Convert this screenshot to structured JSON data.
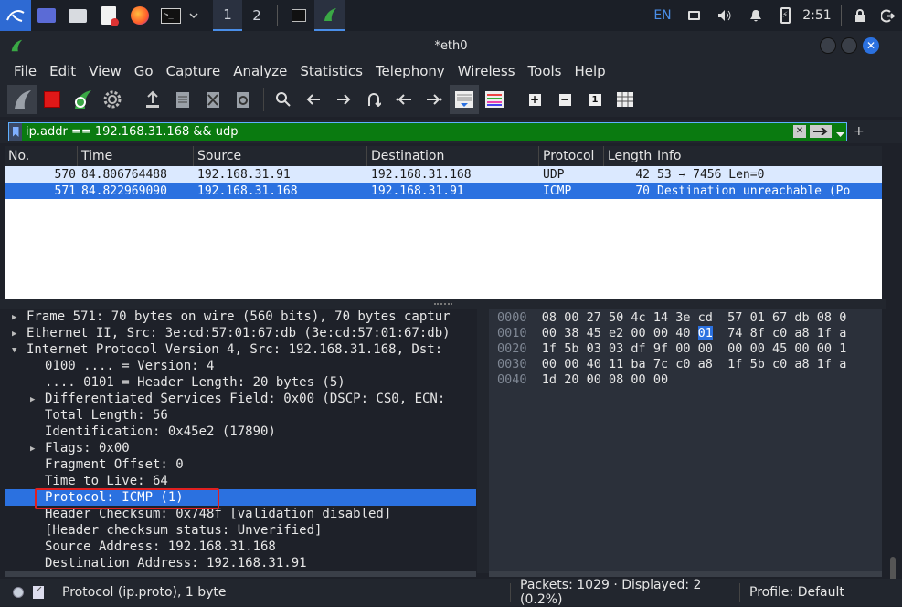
{
  "taskbar": {
    "workspaces": [
      "1",
      "2"
    ],
    "language": "EN",
    "clock": "2:51"
  },
  "window": {
    "title": "*eth0"
  },
  "menu": [
    "File",
    "Edit",
    "View",
    "Go",
    "Capture",
    "Analyze",
    "Statistics",
    "Telephony",
    "Wireless",
    "Tools",
    "Help"
  ],
  "filter": {
    "value": "ip.addr == 192.168.31.168 && udp"
  },
  "packet_list": {
    "columns": [
      "No.",
      "Time",
      "Source",
      "Destination",
      "Protocol",
      "Length",
      "Info"
    ],
    "rows": [
      {
        "no": "570",
        "time": "84.806764488",
        "source": "192.168.31.91",
        "destination": "192.168.31.168",
        "protocol": "UDP",
        "length": "42",
        "info": "53 → 7456 Len=0"
      },
      {
        "no": "571",
        "time": "84.822969090",
        "source": "192.168.31.168",
        "destination": "192.168.31.91",
        "protocol": "ICMP",
        "length": "70",
        "info": "Destination unreachable (Po"
      }
    ]
  },
  "details": [
    {
      "text": "Frame 571: 70 bytes on wire (560 bits), 70 bytes captur",
      "arrow": "right"
    },
    {
      "text": "Ethernet II, Src: 3e:cd:57:01:67:db (3e:cd:57:01:67:db)",
      "arrow": "right"
    },
    {
      "text": "Internet Protocol Version 4, Src: 192.168.31.168, Dst:",
      "arrow": "down"
    },
    {
      "text": "0100 .... = Version: 4",
      "indent": 1
    },
    {
      "text": ".... 0101 = Header Length: 20 bytes (5)",
      "indent": 1
    },
    {
      "text": "Differentiated Services Field: 0x00 (DSCP: CS0, ECN:",
      "indent": 1,
      "arrow": "right"
    },
    {
      "text": "Total Length: 56",
      "indent": 1
    },
    {
      "text": "Identification: 0x45e2 (17890)",
      "indent": 1
    },
    {
      "text": "Flags: 0x00",
      "indent": 1,
      "arrow": "right"
    },
    {
      "text": "Fragment Offset: 0",
      "indent": 1
    },
    {
      "text": "Time to Live: 64",
      "indent": 1
    },
    {
      "text": "Protocol: ICMP (1)",
      "indent": 1,
      "selected": true
    },
    {
      "text": "Header Checksum: 0x748f [validation disabled]",
      "indent": 1
    },
    {
      "text": "[Header checksum status: Unverified]",
      "indent": 1
    },
    {
      "text": "Source Address: 192.168.31.168",
      "indent": 1
    },
    {
      "text": "Destination Address: 192.168.31.91",
      "indent": 1
    }
  ],
  "hex": [
    {
      "offset": "0000",
      "bytes": [
        "08",
        "00",
        "27",
        "50",
        "4c",
        "14",
        "3e",
        "cd",
        "57",
        "01",
        "67",
        "db",
        "08",
        "0"
      ]
    },
    {
      "offset": "0010",
      "bytes": [
        "00",
        "38",
        "45",
        "e2",
        "00",
        "00",
        "40",
        "01",
        "74",
        "8f",
        "c0",
        "a8",
        "1f",
        "a"
      ]
    },
    {
      "offset": "0020",
      "bytes": [
        "1f",
        "5b",
        "03",
        "03",
        "df",
        "9f",
        "00",
        "00",
        "00",
        "00",
        "45",
        "00",
        "00",
        "1"
      ]
    },
    {
      "offset": "0030",
      "bytes": [
        "00",
        "00",
        "40",
        "11",
        "ba",
        "7c",
        "c0",
        "a8",
        "1f",
        "5b",
        "c0",
        "a8",
        "1f",
        "a"
      ]
    },
    {
      "offset": "0040",
      "bytes": [
        "1d",
        "20",
        "00",
        "08",
        "00",
        "00"
      ]
    }
  ],
  "status": {
    "field": "Protocol (ip.proto), 1 byte",
    "packets": "Packets: 1029 · Displayed: 2 (0.2%)",
    "profile": "Profile: Default"
  }
}
